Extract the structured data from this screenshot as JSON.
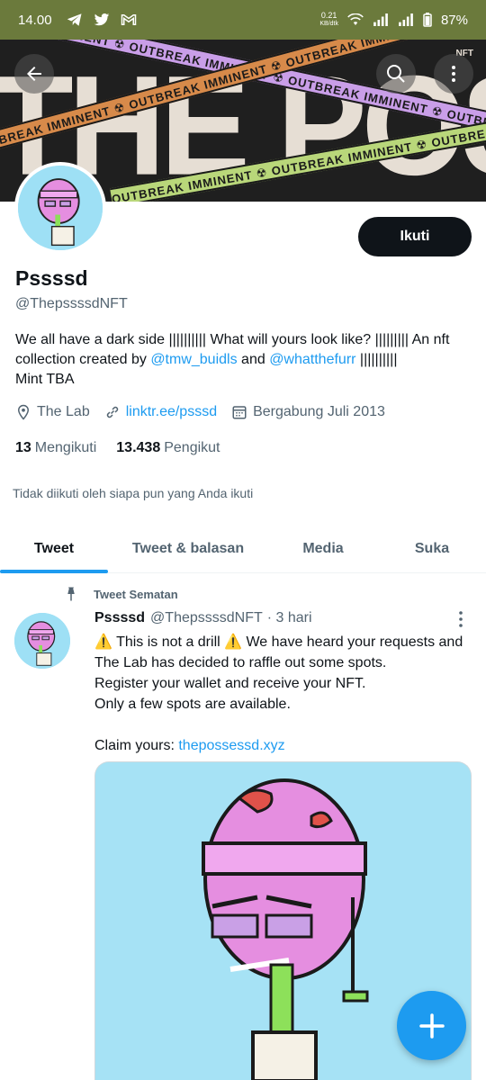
{
  "status_bar": {
    "time": "14.00",
    "net_speed_value": "0.21",
    "net_speed_unit": "KB/dtk",
    "battery": "87%"
  },
  "banner": {
    "big_text": "THE POSSESSED",
    "tape_text": "OUTBREAK IMMINENT ☢ OUTBREAK IMMINENT ☢ OUTBREAK IMMINENT ☢ OUTBREAK IMMINENT",
    "badge": "NFT"
  },
  "header_buttons": {
    "back_icon": "back-arrow-icon",
    "search_icon": "search-icon",
    "more_icon": "more-vertical-icon"
  },
  "profile": {
    "follow_label": "Ikuti",
    "name": "Pssssd",
    "handle": "@ThepssssdNFT",
    "bio_part1": "We all have a dark side |||||||||| What will yours look like? ||||||||| An nft collection created by ",
    "bio_link1": "@tmw_buidls",
    "bio_part2": " and ",
    "bio_link2": "@whatthefurr",
    "bio_part3": " ||||||||||",
    "bio_part4": "Mint TBA",
    "location": "The Lab",
    "website": "linktr.ee/psssd",
    "joined": "Bergabung Juli 2013",
    "following_count": "13",
    "following_label": "Mengikuti",
    "followers_count": "13.438",
    "followers_label": "Pengikut",
    "not_followed_note": "Tidak diikuti oleh siapa pun yang Anda ikuti"
  },
  "tabs": [
    {
      "label": "Tweet"
    },
    {
      "label": "Tweet & balasan"
    },
    {
      "label": "Media"
    },
    {
      "label": "Suka"
    }
  ],
  "tweet": {
    "pinned_label": "Tweet Sematan",
    "author_name": "Pssssd",
    "author_handle": "@ThepssssdNFT",
    "time": "· 3 hari",
    "line1": "⚠️ This is not a drill ⚠️  We have heard your requests and The Lab has decided to raffle out some spots.",
    "line2": "Register your wallet and receive your NFT.",
    "line3": "Only a few spots are available.",
    "claim_label": "Claim yours: ",
    "claim_link": "thepossessd.xyz"
  },
  "colors": {
    "accent": "#1d9bf0",
    "status_bar": "#6b7a3c",
    "text": "#0f1419",
    "muted": "#536471"
  }
}
